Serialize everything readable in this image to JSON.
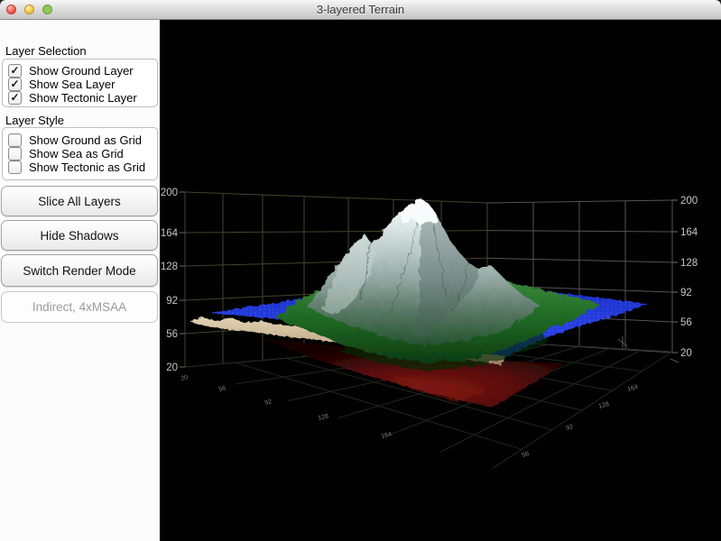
{
  "window": {
    "title": "3-layered Terrain"
  },
  "sidebar": {
    "check_glyph": "✓",
    "layer_selection": {
      "title": "Layer Selection",
      "items": [
        {
          "label": "Show Ground Layer",
          "checked": true
        },
        {
          "label": "Show Sea Layer",
          "checked": true
        },
        {
          "label": "Show Tectonic Layer",
          "checked": true
        }
      ]
    },
    "layer_style": {
      "title": "Layer Style",
      "items": [
        {
          "label": "Show Ground as Grid",
          "checked": false
        },
        {
          "label": "Show Sea as Grid",
          "checked": false
        },
        {
          "label": "Show Tectonic as Grid",
          "checked": false
        }
      ]
    },
    "buttons": {
      "slice": "Slice All Layers",
      "shadows": "Hide Shadows",
      "render": "Switch Render Mode"
    },
    "status": "Indirect, 4xMSAA"
  },
  "viewport": {
    "left_axis": [
      "200",
      "164",
      "128",
      "92",
      "56",
      "20"
    ],
    "right_axis": [
      "200",
      "164",
      "128",
      "92",
      "56",
      "20"
    ],
    "floor_ticks_left": [
      "20",
      "56",
      "92",
      "128",
      "164"
    ],
    "floor_ticks_right": [
      "164",
      "128",
      "92",
      "56"
    ],
    "colors": {
      "sea": "#2a3fe0",
      "ground_rim": "#c4b190",
      "tectonic": "#6b0f0f",
      "terrain_green": "#1f6b28",
      "mountain": "#dce6e4",
      "wall_grid_left": "#4a4632",
      "wall_grid_right": "#555555"
    }
  }
}
